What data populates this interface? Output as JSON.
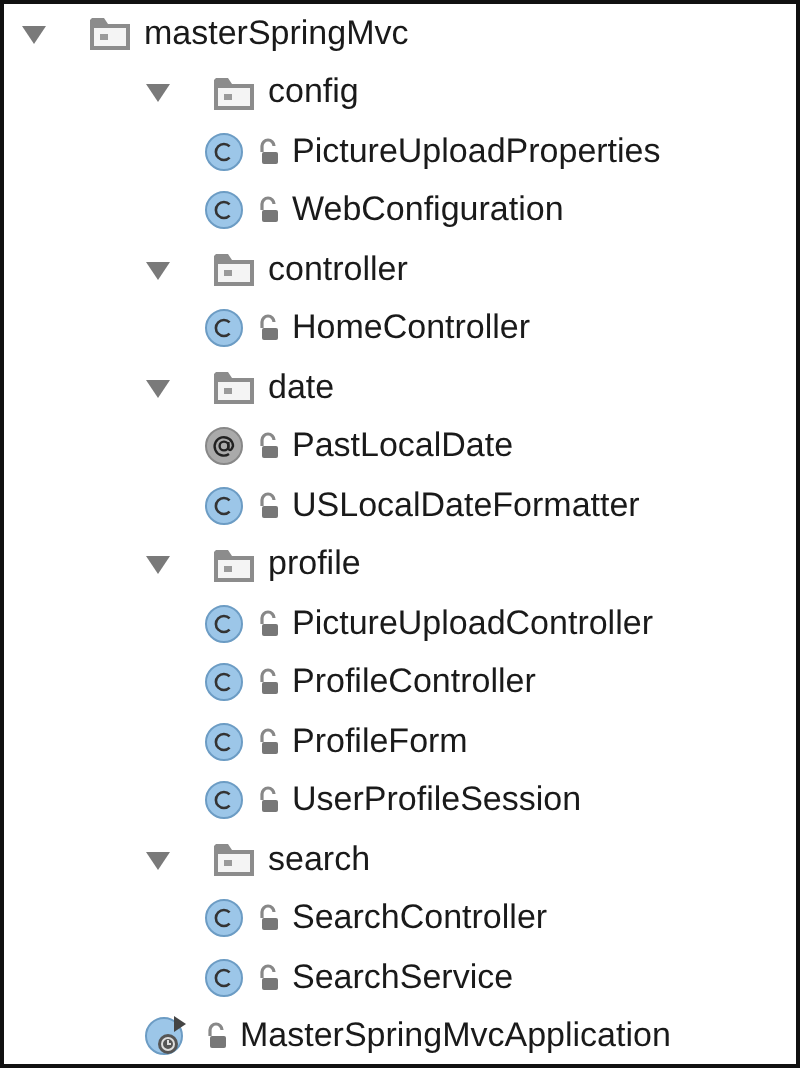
{
  "tree": [
    {
      "label": "masterSpringMvc",
      "kind": "module",
      "expanded": true,
      "children": [
        {
          "label": "config",
          "kind": "package",
          "expanded": true,
          "children": [
            {
              "label": "PictureUploadProperties",
              "kind": "class"
            },
            {
              "label": "WebConfiguration",
              "kind": "class"
            }
          ]
        },
        {
          "label": "controller",
          "kind": "package",
          "expanded": true,
          "children": [
            {
              "label": "HomeController",
              "kind": "class"
            }
          ]
        },
        {
          "label": "date",
          "kind": "package",
          "expanded": true,
          "children": [
            {
              "label": "PastLocalDate",
              "kind": "annotation"
            },
            {
              "label": "USLocalDateFormatter",
              "kind": "class"
            }
          ]
        },
        {
          "label": "profile",
          "kind": "package",
          "expanded": true,
          "children": [
            {
              "label": "PictureUploadController",
              "kind": "class"
            },
            {
              "label": "ProfileController",
              "kind": "class"
            },
            {
              "label": "ProfileForm",
              "kind": "class"
            },
            {
              "label": "UserProfileSession",
              "kind": "class"
            }
          ]
        },
        {
          "label": "search",
          "kind": "package",
          "expanded": true,
          "children": [
            {
              "label": "SearchController",
              "kind": "class"
            },
            {
              "label": "SearchService",
              "kind": "class"
            }
          ]
        },
        {
          "label": "MasterSpringMvcApplication",
          "kind": "app"
        }
      ]
    }
  ]
}
